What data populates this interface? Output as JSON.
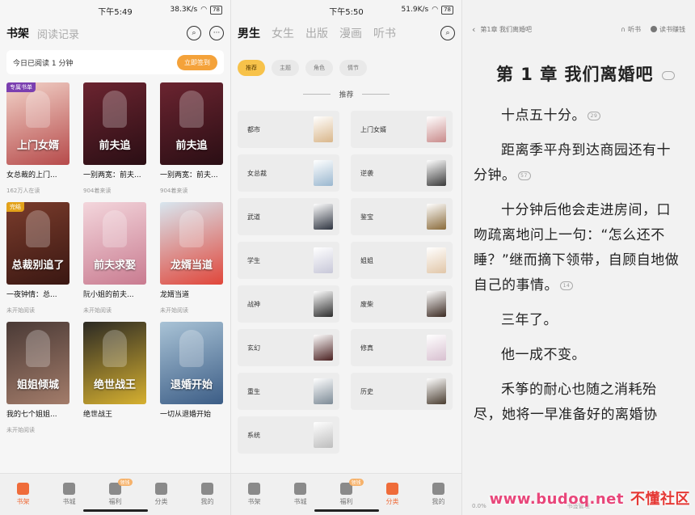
{
  "panel1": {
    "status": {
      "time": "下午5:49",
      "speed": "38.3K/s",
      "battery": "78"
    },
    "header": {
      "tabs": [
        "书架",
        "阅读记录"
      ]
    },
    "reading_bar": {
      "text": "今日已阅读 1 分钟",
      "button": "立即签到"
    },
    "books": [
      {
        "flag": "专属书单",
        "cover_title": "上门女婿",
        "title": "女总裁的上门...",
        "meta": "162万人在读",
        "c1": "#f2d3c9",
        "c2": "#b64a4a"
      },
      {
        "flag": "",
        "cover_title": "前夫追",
        "title": "一别两宽：前夫...",
        "meta": "904着来读",
        "c1": "#6b2430",
        "c2": "#2a0e14"
      },
      {
        "flag": "",
        "cover_title": "前夫追",
        "title": "一别两宽：前夫...",
        "meta": "904着来读",
        "c1": "#6b2430",
        "c2": "#2a0e14"
      },
      {
        "flag": "完结",
        "cover_title": "总裁别追了",
        "title": "一夜钟情：总...",
        "meta": "未开始阅读",
        "c1": "#7a3c2c",
        "c2": "#3a1712"
      },
      {
        "flag": "",
        "cover_title": "前夫求娶",
        "title": "阮小姐的前夫...",
        "meta": "未开始阅读",
        "c1": "#f3d6dc",
        "c2": "#c97b90"
      },
      {
        "flag": "",
        "cover_title": "龙婿当道",
        "title": "龙婿当道",
        "meta": "未开始阅读",
        "c1": "#d8e6ef",
        "c2": "#e0463a"
      },
      {
        "flag": "",
        "cover_title": "姐姐倾城",
        "title": "我的七个姐姐...",
        "meta": "未开始阅读",
        "c1": "#4a3a36",
        "c2": "#a37c6a"
      },
      {
        "flag": "",
        "cover_title": "绝世战王",
        "title": "绝世战王",
        "meta": "",
        "c1": "#2c2a24",
        "c2": "#d6b030"
      },
      {
        "flag": "",
        "cover_title": "退婚开始",
        "title": "一切从退婚开始",
        "meta": "",
        "c1": "#a9c3d6",
        "c2": "#3c5d86"
      }
    ],
    "nav": [
      {
        "label": "书架",
        "active": true,
        "badge": ""
      },
      {
        "label": "书城",
        "active": false,
        "badge": ""
      },
      {
        "label": "福利",
        "active": false,
        "badge": "领钱"
      },
      {
        "label": "分类",
        "active": false,
        "badge": ""
      },
      {
        "label": "我的",
        "active": false,
        "badge": ""
      }
    ]
  },
  "panel2": {
    "status": {
      "time": "下午5:50",
      "speed": "51.9K/s",
      "battery": "78"
    },
    "header": {
      "tabs": [
        "男生",
        "女生",
        "出版",
        "漫画",
        "听书"
      ]
    },
    "chips": [
      "推荐",
      "主题",
      "角色",
      "情节"
    ],
    "section": "推荐",
    "categories": [
      {
        "name": "都市",
        "color": "#d9b68a"
      },
      {
        "name": "上门女婿",
        "color": "#c98b8b"
      },
      {
        "name": "女总裁",
        "color": "#9ab7cf"
      },
      {
        "name": "逆袭",
        "color": "#3a3a3a"
      },
      {
        "name": "武道",
        "color": "#2e3440"
      },
      {
        "name": "鉴宝",
        "color": "#8a6b3a"
      },
      {
        "name": "学生",
        "color": "#c7c7d8"
      },
      {
        "name": "姐姐",
        "color": "#e1c6a8"
      },
      {
        "name": "战神",
        "color": "#2c2c2c"
      },
      {
        "name": "废柴",
        "color": "#3b2a22"
      },
      {
        "name": "玄幻",
        "color": "#4a2020"
      },
      {
        "name": "修真",
        "color": "#d8c0d0"
      },
      {
        "name": "重生",
        "color": "#7c8a96"
      },
      {
        "name": "历史",
        "color": "#4a3d30"
      },
      {
        "name": "系统",
        "color": "#bdbdbd"
      }
    ],
    "nav": [
      {
        "label": "书架",
        "active": false,
        "badge": ""
      },
      {
        "label": "书城",
        "active": false,
        "badge": ""
      },
      {
        "label": "福利",
        "active": false,
        "badge": "领钱"
      },
      {
        "label": "分类",
        "active": true,
        "badge": ""
      },
      {
        "label": "我的",
        "active": false,
        "badge": ""
      }
    ]
  },
  "panel3": {
    "top": {
      "back_label": "第1章 我们离婚吧",
      "listen": "听书",
      "earn": "读书赚钱"
    },
    "chapter_title": "第 1 章 我们离婚吧",
    "paragraphs": [
      {
        "text": "十点五十分。",
        "comment": "29"
      },
      {
        "text": "距离季平舟到达商园还有十分钟。",
        "comment": "57"
      },
      {
        "text": "十分钟后他会走进房间，口吻疏离地问上一句：“怎么还不睡？”继而摘下领带，自顾自地做自己的事情。",
        "comment": "14"
      },
      {
        "text": "三年了。",
        "comment": ""
      },
      {
        "text": "他一成不变。",
        "comment": ""
      },
      {
        "text": "禾筝的耐心也随之消耗殆尽，她将一早准备好的离婚协",
        "comment": ""
      }
    ],
    "bottom": {
      "progress": "0.0%",
      "mid": "书签管理"
    },
    "watermark": {
      "site": "www.budoq.net",
      "name": "不懂社区"
    }
  }
}
